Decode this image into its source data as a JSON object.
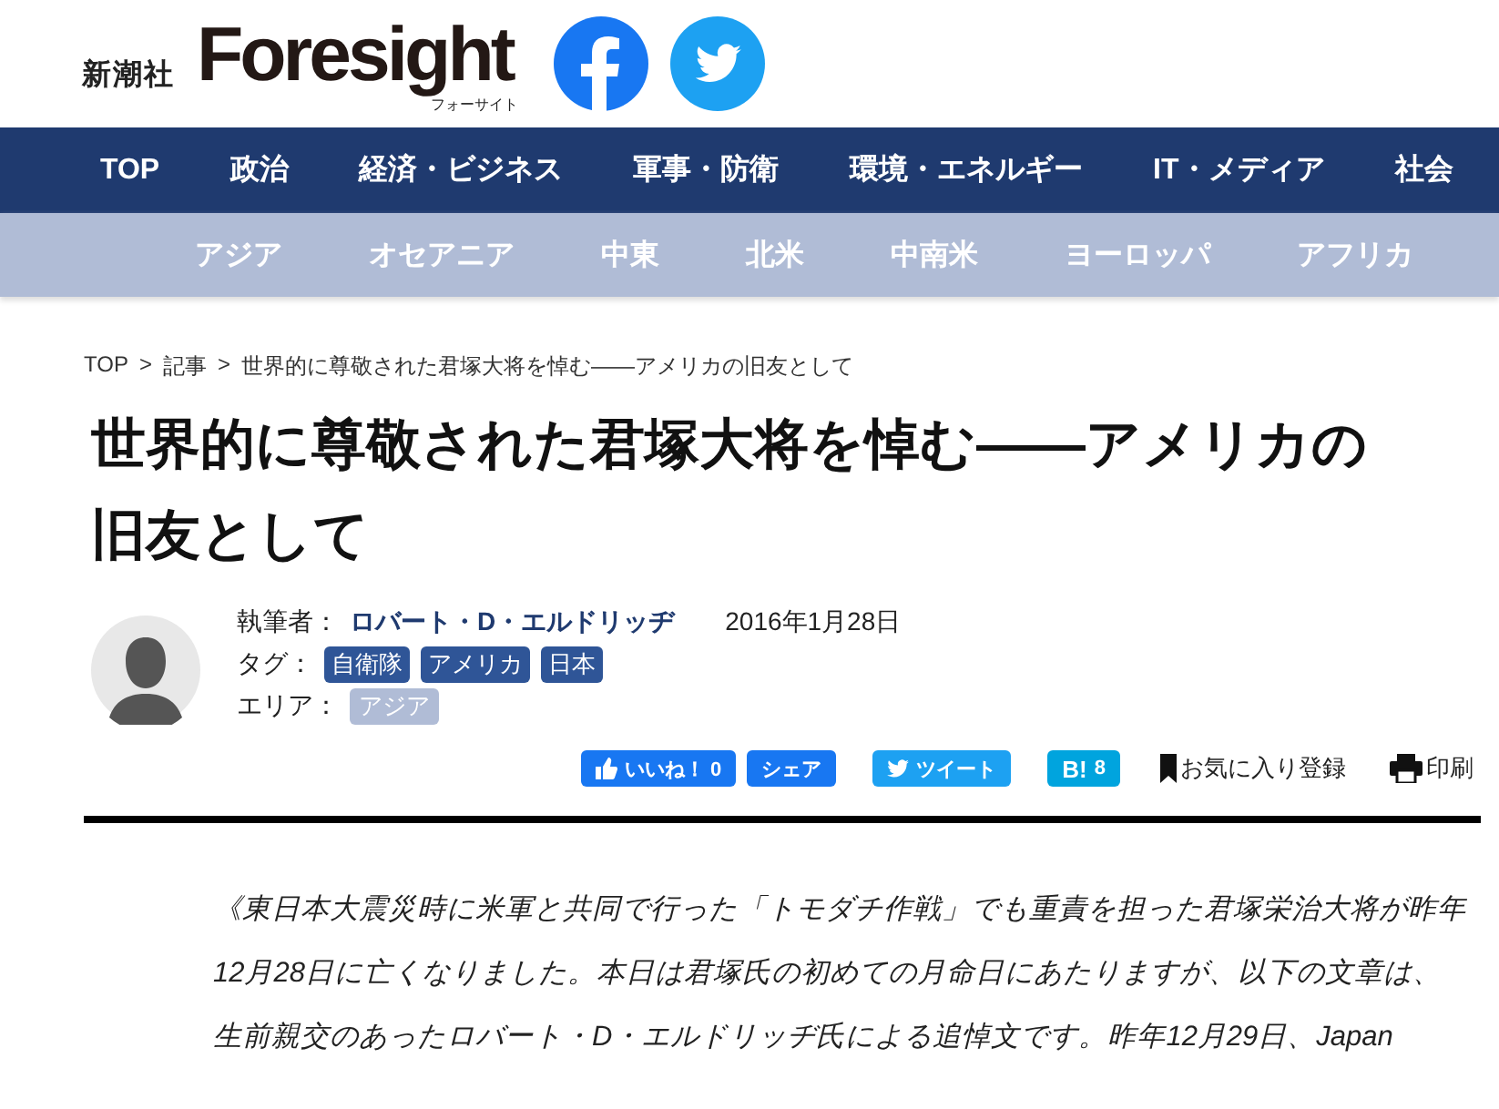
{
  "header": {
    "publisher": "新潮社",
    "logo": "Foresight",
    "logo_sub": "フォーサイト"
  },
  "main_nav": [
    "TOP",
    "政治",
    "経済・ビジネス",
    "軍事・防衛",
    "環境・エネルギー",
    "IT・メディア",
    "社会"
  ],
  "region_nav": [
    "アジア",
    "オセアニア",
    "中東",
    "北米",
    "中南米",
    "ヨーロッパ",
    "アフリカ"
  ],
  "breadcrumb": {
    "separator": ">",
    "items": [
      "TOP",
      "記事",
      "世界的に尊敬された君塚大将を悼む――アメリカの旧友として"
    ]
  },
  "article": {
    "title": "世界的に尊敬された君塚大将を悼む――アメリカの旧友として",
    "author_label": "執筆者：",
    "author": "ロバート・D・エルドリッヂ",
    "date": "2016年1月28日",
    "tags_label": "タグ：",
    "tags": [
      "自衛隊",
      "アメリカ",
      "日本"
    ],
    "area_label": "エリア：",
    "areas": [
      "アジア"
    ]
  },
  "share": [
    {
      "kind": "like",
      "label": "いいね！",
      "count": "0"
    },
    {
      "kind": "share",
      "label": "シェア"
    },
    {
      "kind": "tweet",
      "label": "ツイート"
    },
    {
      "kind": "hatena",
      "label": "B!",
      "count": "8"
    },
    {
      "kind": "bookmark",
      "label": "お気に入り登録"
    },
    {
      "kind": "print",
      "label": "印刷"
    }
  ],
  "lead_lines": [
    "《東日本大震災時に米軍と共同で行った「トモダチ作戦」でも重責を担った君塚栄治大将が昨年",
    "12月28日に亡くなりました。本日は君塚氏の初めての月命日にあたりますが、以下の文章は、",
    "生前親交のあったロバート・D・エルドリッヂ氏による追悼文です。昨年12月29日、Japan"
  ]
}
